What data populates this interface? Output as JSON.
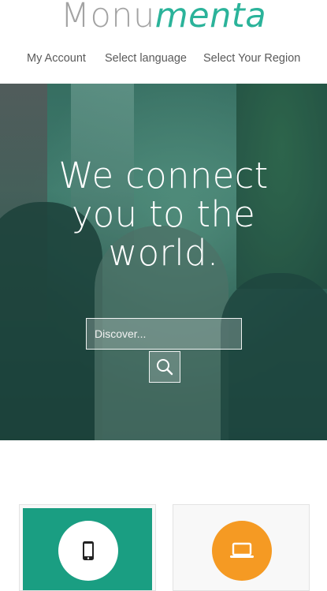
{
  "header": {
    "logo_part1": "Monu",
    "logo_part2": "menta",
    "nav": [
      {
        "label": "My Account"
      },
      {
        "label": "Select language"
      },
      {
        "label": "Select Your Region"
      }
    ]
  },
  "hero": {
    "headline_line1": "We connect",
    "headline_line2": "you to the",
    "headline_line3": "world.",
    "search_placeholder": "Discover..."
  },
  "cards": [
    {
      "icon": "smartphone-icon",
      "color": "#1a9e82"
    },
    {
      "icon": "laptop-icon",
      "color": "#f59a23"
    }
  ],
  "colors": {
    "brand_gray": "#a3a3a3",
    "brand_green": "#2bb39a"
  }
}
